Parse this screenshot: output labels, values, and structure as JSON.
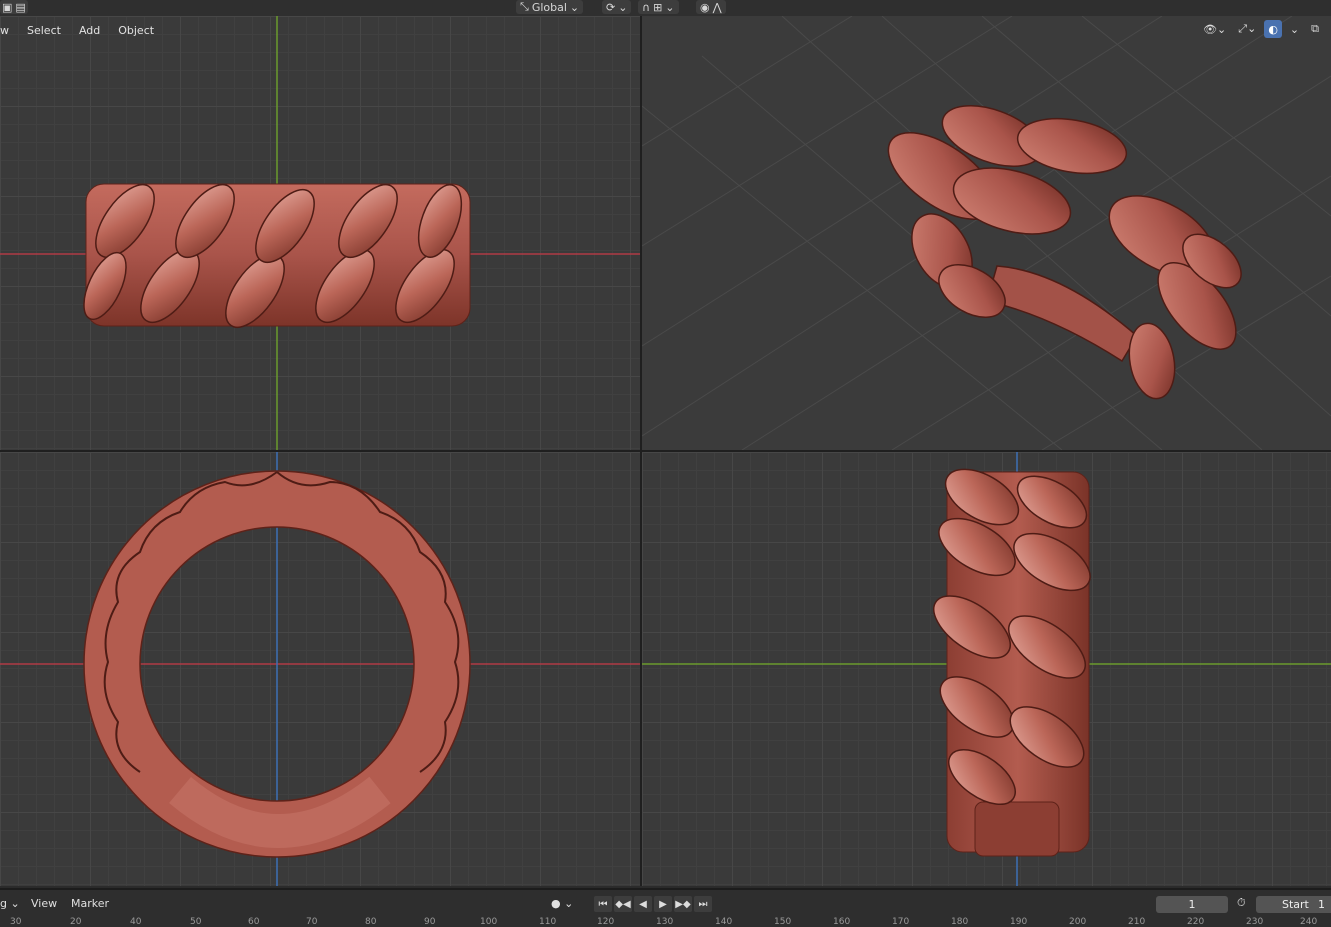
{
  "topbar": {
    "orientation_label": "Global",
    "orientation_icon": "transform-orientation-icon",
    "pivot_icon": "pivot-point-icon",
    "snap_icon": "snap-magnet-icon",
    "snap_target_icon": "snap-increment-icon",
    "proportional_icon": "proportional-edit-icon",
    "falloff_icon": "falloff-curve-icon"
  },
  "viewport_menu": {
    "partial_label": "w",
    "items": [
      "Select",
      "Add",
      "Object"
    ]
  },
  "viewport_header_icons": [
    "visibility-eye-icon",
    "gizmo-icon",
    "overlay-icon",
    "xray-icon"
  ],
  "timeline": {
    "partial_label": "g",
    "menu_items": [
      "View",
      "Marker"
    ],
    "current_frame": "1",
    "start_label": "Start",
    "start_value": "1",
    "ruler_ticks": [
      "30",
      "20",
      "40",
      "50",
      "60",
      "70",
      "80",
      "90",
      "100",
      "110",
      "120",
      "130",
      "140",
      "150",
      "160",
      "170",
      "180",
      "190",
      "200",
      "210",
      "220",
      "230",
      "240"
    ]
  },
  "colors": {
    "ring": "#b35c4f",
    "ring_dark": "#6b2a22",
    "ring_light": "#d9968a",
    "axis_x": "#b03a45",
    "axis_y": "#6b9a2c",
    "axis_z": "#3d6fb5",
    "grid_bg": "#3a3a3a"
  }
}
